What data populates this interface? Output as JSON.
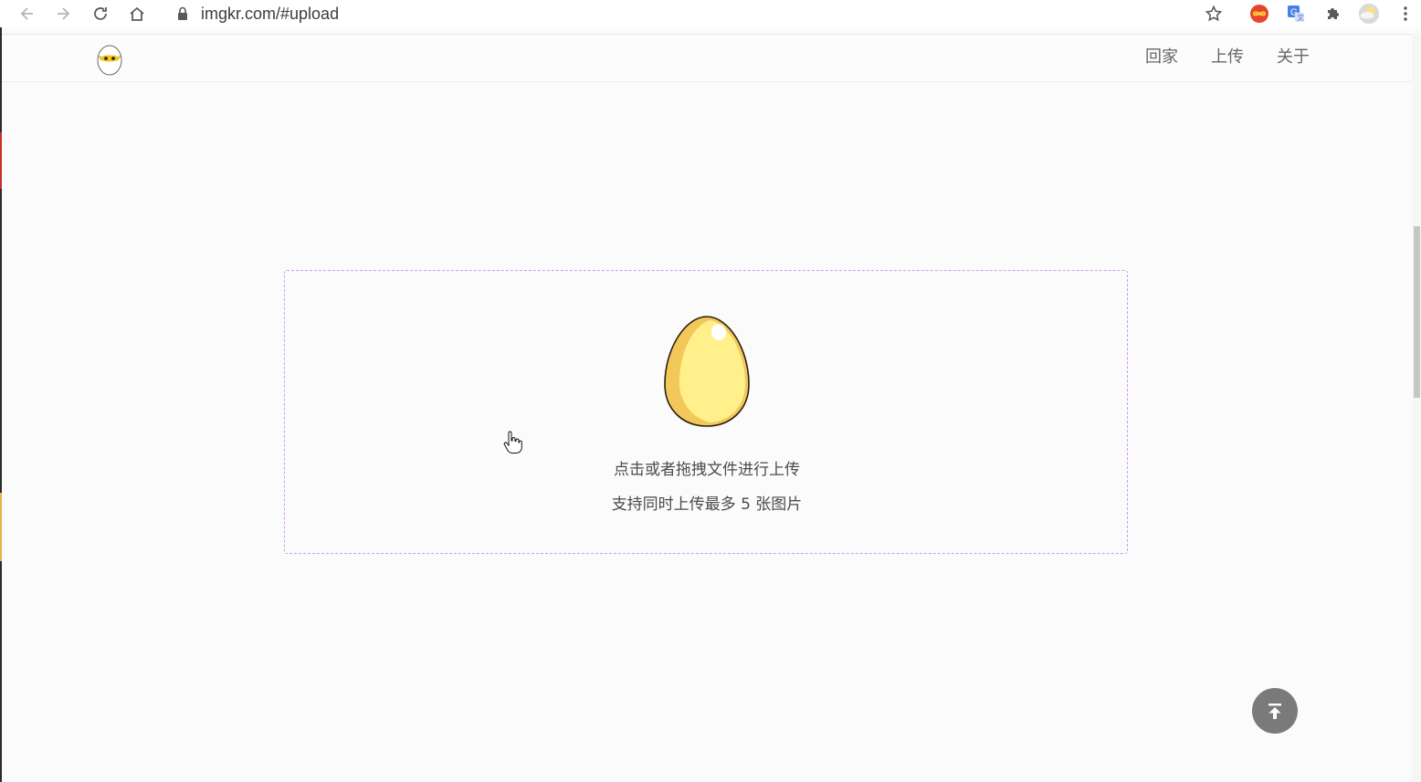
{
  "browser": {
    "url": "imgkr.com/#upload",
    "icons": [
      "back-arrow-icon",
      "forward-arrow-icon",
      "reload-icon",
      "home-icon",
      "lock-icon",
      "bookmark-star-icon",
      "infinity-extension-icon",
      "translate-extension-icon",
      "extensions-puzzle-icon",
      "profile-avatar-icon",
      "menu-dots-icon"
    ]
  },
  "site": {
    "logo": "egg-logo-icon",
    "nav": {
      "home": "回家",
      "upload": "上传",
      "about": "关于"
    }
  },
  "upload": {
    "line1": "点击或者拖拽文件进行上传",
    "line2": "支持同时上传最多 5 张图片",
    "egg_icon": "golden-egg-icon",
    "border_color": "#d49ae6"
  },
  "back_to_top": {
    "icon": "arrow-up-to-top-icon",
    "color": "#7a7a7a"
  }
}
